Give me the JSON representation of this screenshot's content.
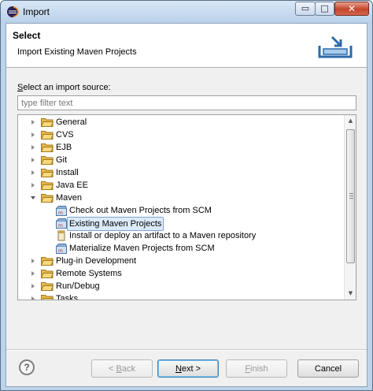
{
  "window": {
    "title": "Import",
    "minimize": "▭",
    "maximize": "□",
    "close": "✕"
  },
  "header": {
    "title": "Select",
    "description": "Import Existing Maven Projects"
  },
  "source": {
    "label_prefix": "S",
    "label_rest": "elect an import source:",
    "filter_placeholder": "type filter text"
  },
  "tree": {
    "items": [
      {
        "label": "General",
        "level": 0,
        "kind": "folder",
        "state": "closed"
      },
      {
        "label": "CVS",
        "level": 0,
        "kind": "folder",
        "state": "closed"
      },
      {
        "label": "EJB",
        "level": 0,
        "kind": "folder",
        "state": "closed"
      },
      {
        "label": "Git",
        "level": 0,
        "kind": "folder",
        "state": "closed"
      },
      {
        "label": "Install",
        "level": 0,
        "kind": "folder",
        "state": "closed"
      },
      {
        "label": "Java EE",
        "level": 0,
        "kind": "folder",
        "state": "closed"
      },
      {
        "label": "Maven",
        "level": 0,
        "kind": "folder",
        "state": "open"
      },
      {
        "label": "Check out Maven Projects from SCM",
        "level": 1,
        "kind": "maven-project"
      },
      {
        "label": "Existing Maven Projects",
        "level": 1,
        "kind": "maven-project",
        "selected": true
      },
      {
        "label": "Install or deploy an artifact to a Maven repository",
        "level": 1,
        "kind": "jar"
      },
      {
        "label": "Materialize Maven Projects from SCM",
        "level": 1,
        "kind": "maven-project"
      },
      {
        "label": "Plug-in Development",
        "level": 0,
        "kind": "folder",
        "state": "closed"
      },
      {
        "label": "Remote Systems",
        "level": 0,
        "kind": "folder",
        "state": "closed"
      },
      {
        "label": "Run/Debug",
        "level": 0,
        "kind": "folder",
        "state": "closed"
      },
      {
        "label": "Tasks",
        "level": 0,
        "kind": "folder",
        "state": "closed"
      }
    ],
    "scroll_up": "▲",
    "scroll_down": "▼"
  },
  "buttons": {
    "help": "?",
    "back_pre": "< ",
    "back_key": "B",
    "back_post": "ack",
    "next_key": "N",
    "next_post": "ext >",
    "finish_key": "F",
    "finish_post": "inish",
    "cancel": "Cancel"
  },
  "colors": {
    "accent": "#3c7fb1",
    "selection": "#dcebfc",
    "folder": "#e8b84a"
  }
}
